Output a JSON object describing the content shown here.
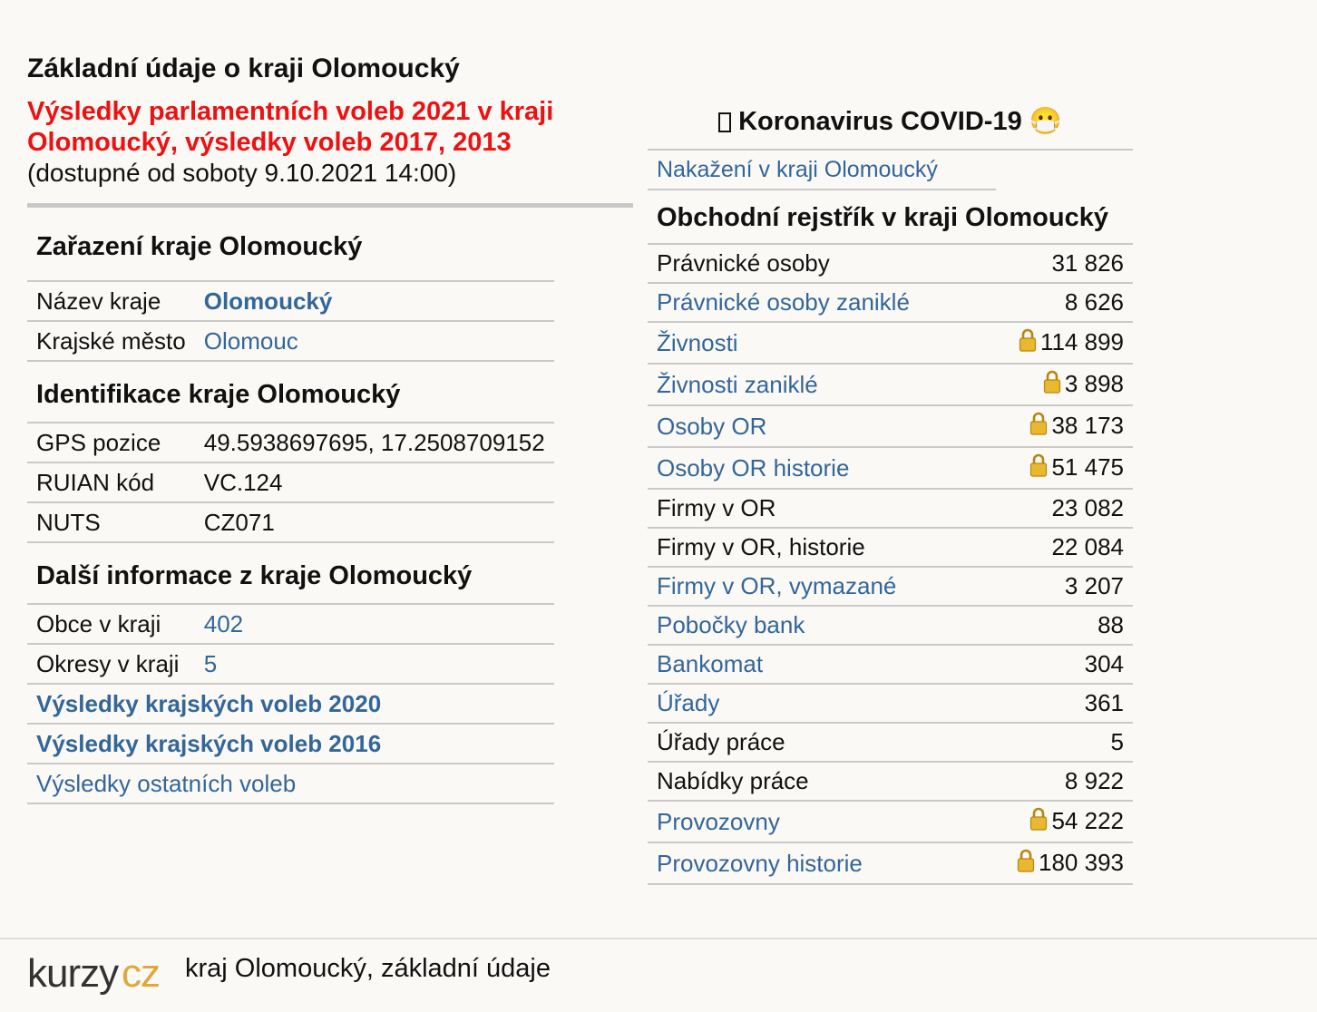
{
  "main_title": "Základní údaje o kraji Olomoucký",
  "election_link": "Výsledky parlamentních voleb 2021 v kraji Olomoucký, výsledky voleb 2017, 2013",
  "availability_note": "(dostupné od soboty 9.10.2021 14:00)",
  "classification": {
    "heading": "Zařazení kraje Olomoucký",
    "rows": [
      {
        "label": "Název kraje",
        "value": "Olomoucký"
      },
      {
        "label": "Krajské město",
        "value": "Olomouc"
      }
    ]
  },
  "identification": {
    "heading": "Identifikace kraje Olomoucký",
    "rows": [
      {
        "label": "GPS pozice",
        "value": "49.5938697695, 17.2508709152"
      },
      {
        "label": "RUIAN kód",
        "value": "VC.124"
      },
      {
        "label": "NUTS",
        "value": "CZ071"
      }
    ]
  },
  "more_info": {
    "heading": "Další informace z kraje Olomoucký",
    "rows": [
      {
        "label": "Obce v kraji",
        "value": "402"
      },
      {
        "label": "Okresy v kraji",
        "value": "5"
      }
    ],
    "links": [
      "Výsledky krajských voleb 2020",
      "Výsledky krajských voleb 2016",
      "Výsledky ostatních voleb"
    ]
  },
  "covid": {
    "title_icon": "missing-glyph-icon",
    "title": "Koronavirus COVID-19",
    "title_emoji": "😷",
    "link": "Nakažení v kraji Olomoucký"
  },
  "business_register": {
    "heading": "Obchodní rejstřík v kraji Olomoucký",
    "rows": [
      {
        "label": "Právnické osoby",
        "value": "31 826",
        "link": false,
        "locked": false
      },
      {
        "label": "Právnické osoby zaniklé",
        "value": "8 626",
        "link": true,
        "locked": false
      },
      {
        "label": "Živnosti",
        "value": "114 899",
        "link": true,
        "locked": true
      },
      {
        "label": "Živnosti zaniklé",
        "value": "3 898",
        "link": true,
        "locked": true
      },
      {
        "label": "Osoby OR",
        "value": "38 173",
        "link": true,
        "locked": true
      },
      {
        "label": "Osoby OR historie",
        "value": "51 475",
        "link": true,
        "locked": true
      },
      {
        "label": "Firmy v OR",
        "value": "23 082",
        "link": false,
        "locked": false
      },
      {
        "label": "Firmy v OR, historie",
        "value": "22 084",
        "link": false,
        "locked": false
      },
      {
        "label": "Firmy v OR, vymazané",
        "value": "3 207",
        "link": true,
        "locked": false
      },
      {
        "label": "Pobočky bank",
        "value": "88",
        "link": true,
        "locked": false
      },
      {
        "label": "Bankomat",
        "value": "304",
        "link": true,
        "locked": false
      },
      {
        "label": "Úřady",
        "value": "361",
        "link": true,
        "locked": false
      },
      {
        "label": "Úřady práce",
        "value": "5",
        "link": false,
        "locked": false
      },
      {
        "label": "Nabídky práce",
        "value": "8 922",
        "link": false,
        "locked": false
      },
      {
        "label": "Provozovny",
        "value": "54 222",
        "link": true,
        "locked": true
      },
      {
        "label": "Provozovny historie",
        "value": "180 393",
        "link": true,
        "locked": true
      }
    ]
  },
  "footer": {
    "logo_part1": "kurzy",
    "logo_part2": "cz",
    "text": "kraj Olomoucký, základní údaje"
  },
  "colors": {
    "link": "#336699",
    "election_red": "#ee1111",
    "logo_gold": "#e0a83a",
    "logo_dark": "#333333"
  }
}
